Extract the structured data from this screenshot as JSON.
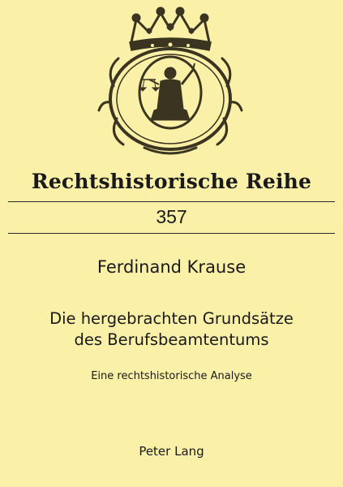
{
  "cover": {
    "series_title": "Rechtshistorische Reihe",
    "volume_number": "357",
    "author": "Ferdinand Krause",
    "title_line_1": "Die hergebrachten Grundsätze",
    "title_line_2": "des Berufsbeamtentums",
    "subtitle": "Eine rechtshistorische Analyse",
    "publisher": "Peter Lang"
  },
  "seal": {
    "icon": "crowned-justitia-seal-icon",
    "ink_color": "#3a3420",
    "background_color": "#fbf0a8"
  }
}
